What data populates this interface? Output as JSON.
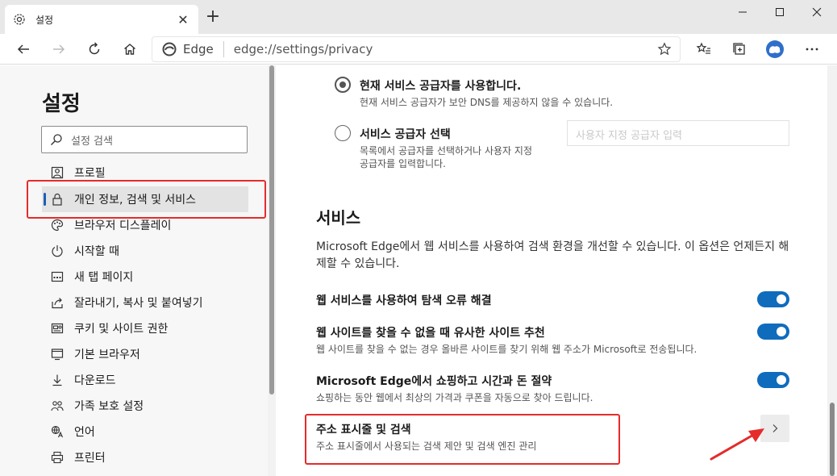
{
  "tab": {
    "title": "설정",
    "close": "✕",
    "new_tab": "+"
  },
  "address": {
    "edge_label": "Edge",
    "url": "edge://settings/privacy"
  },
  "sidebar": {
    "title": "설정",
    "search_placeholder": "설정 검색",
    "items": [
      {
        "label": "프로필",
        "icon": "profile-icon"
      },
      {
        "label": "개인 정보, 검색 및 서비스",
        "icon": "lock-icon"
      },
      {
        "label": "브라우저 디스플레이",
        "icon": "palette-icon"
      },
      {
        "label": "시작할 때",
        "icon": "power-icon"
      },
      {
        "label": "새 탭 페이지",
        "icon": "newtab-icon"
      },
      {
        "label": "잘라내기, 복사 및 붙여넣기",
        "icon": "share-icon"
      },
      {
        "label": "쿠키 및 사이트 권한",
        "icon": "site-permissions-icon"
      },
      {
        "label": "기본 브라우저",
        "icon": "default-browser-icon"
      },
      {
        "label": "다운로드",
        "icon": "download-icon"
      },
      {
        "label": "가족 보호 설정",
        "icon": "family-icon"
      },
      {
        "label": "언어",
        "icon": "language-icon"
      },
      {
        "label": "프린터",
        "icon": "printer-icon"
      }
    ]
  },
  "dns": {
    "current_title": "현재 서비스 공급자를 사용합니다.",
    "current_sub": "현재 서비스 공급자가 보안 DNS를 제공하지 않을 수 있습니다.",
    "choose_title": "서비스 공급자 선택",
    "choose_sub_1": "목록에서 공급자를 선택하거나 사용자 지정",
    "choose_sub_2": "공급자를 입력합니다.",
    "provider_placeholder": "사용자 지정 공급자 입력"
  },
  "services": {
    "heading": "서비스",
    "description": "Microsoft Edge에서 웹 서비스를 사용하여 검색 환경을 개선할 수 있습니다. 이 옵션은 언제든지 해제할 수 있습니다.",
    "items": [
      {
        "title": "웹 서비스를 사용하여 탐색 오류 해결",
        "sub": "",
        "enabled": true
      },
      {
        "title": "웹 사이트를 찾을 수 없을 때 유사한 사이트 추천",
        "sub": "웹 사이트를 찾을 수 없는 경우 올바른 사이트를 찾기 위해 웹 주소가 Microsoft로 전송됩니다.",
        "enabled": true
      },
      {
        "title": "Microsoft Edge에서 쇼핑하고 시간과 돈 절약",
        "sub": "쇼핑하는 동안 웹에서 최상의 가격과 쿠폰을 자동으로 찾아 드립니다.",
        "enabled": true
      }
    ],
    "address_bar": {
      "title": "주소 표시줄 및 검색",
      "sub": "주소 표시줄에서 사용되는 검색 제안 및 검색 엔진 관리"
    }
  },
  "colors": {
    "accent": "#0f6cbd",
    "annotation_red": "#e52b2b"
  }
}
